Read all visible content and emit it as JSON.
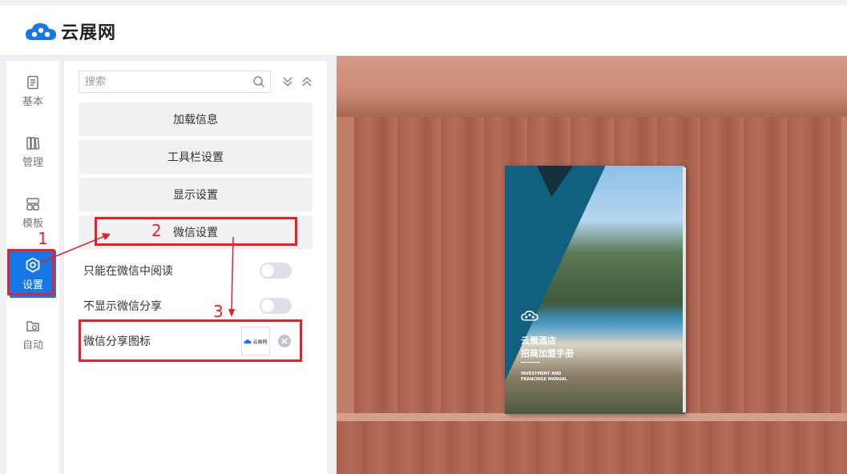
{
  "header": {
    "logo_text": "云展网"
  },
  "left_nav": {
    "items": [
      {
        "label": "基本",
        "icon": "document-icon"
      },
      {
        "label": "管理",
        "icon": "books-icon"
      },
      {
        "label": "模板",
        "icon": "template-grid-icon"
      },
      {
        "label": "设置",
        "icon": "gear-hexagon-icon",
        "active": true
      },
      {
        "label": "自动",
        "icon": "folder-refresh-icon"
      }
    ]
  },
  "panel": {
    "search": {
      "placeholder": "搜索",
      "value": ""
    },
    "sections": [
      {
        "label": "加载信息"
      },
      {
        "label": "工具栏设置"
      },
      {
        "label": "显示设置"
      },
      {
        "label": "微信设置"
      }
    ],
    "wechat_options": [
      {
        "label": "只能在微信中阅读",
        "enabled": false
      },
      {
        "label": "不显示微信分享",
        "enabled": false
      }
    ],
    "share_icon": {
      "label": "微信分享图标",
      "thumb_text": "云展网"
    }
  },
  "preview": {
    "book": {
      "title_line1": "云展酒店",
      "title_line2": "招商加盟手册",
      "en_line1": "INVESTMENT AND",
      "en_line2": "FRANCHISE MANUAL"
    }
  },
  "annotations": {
    "step1": "1",
    "step2": "2",
    "step3": "3"
  },
  "colors": {
    "accent": "#1677e6",
    "annotation": "#e8202a"
  }
}
